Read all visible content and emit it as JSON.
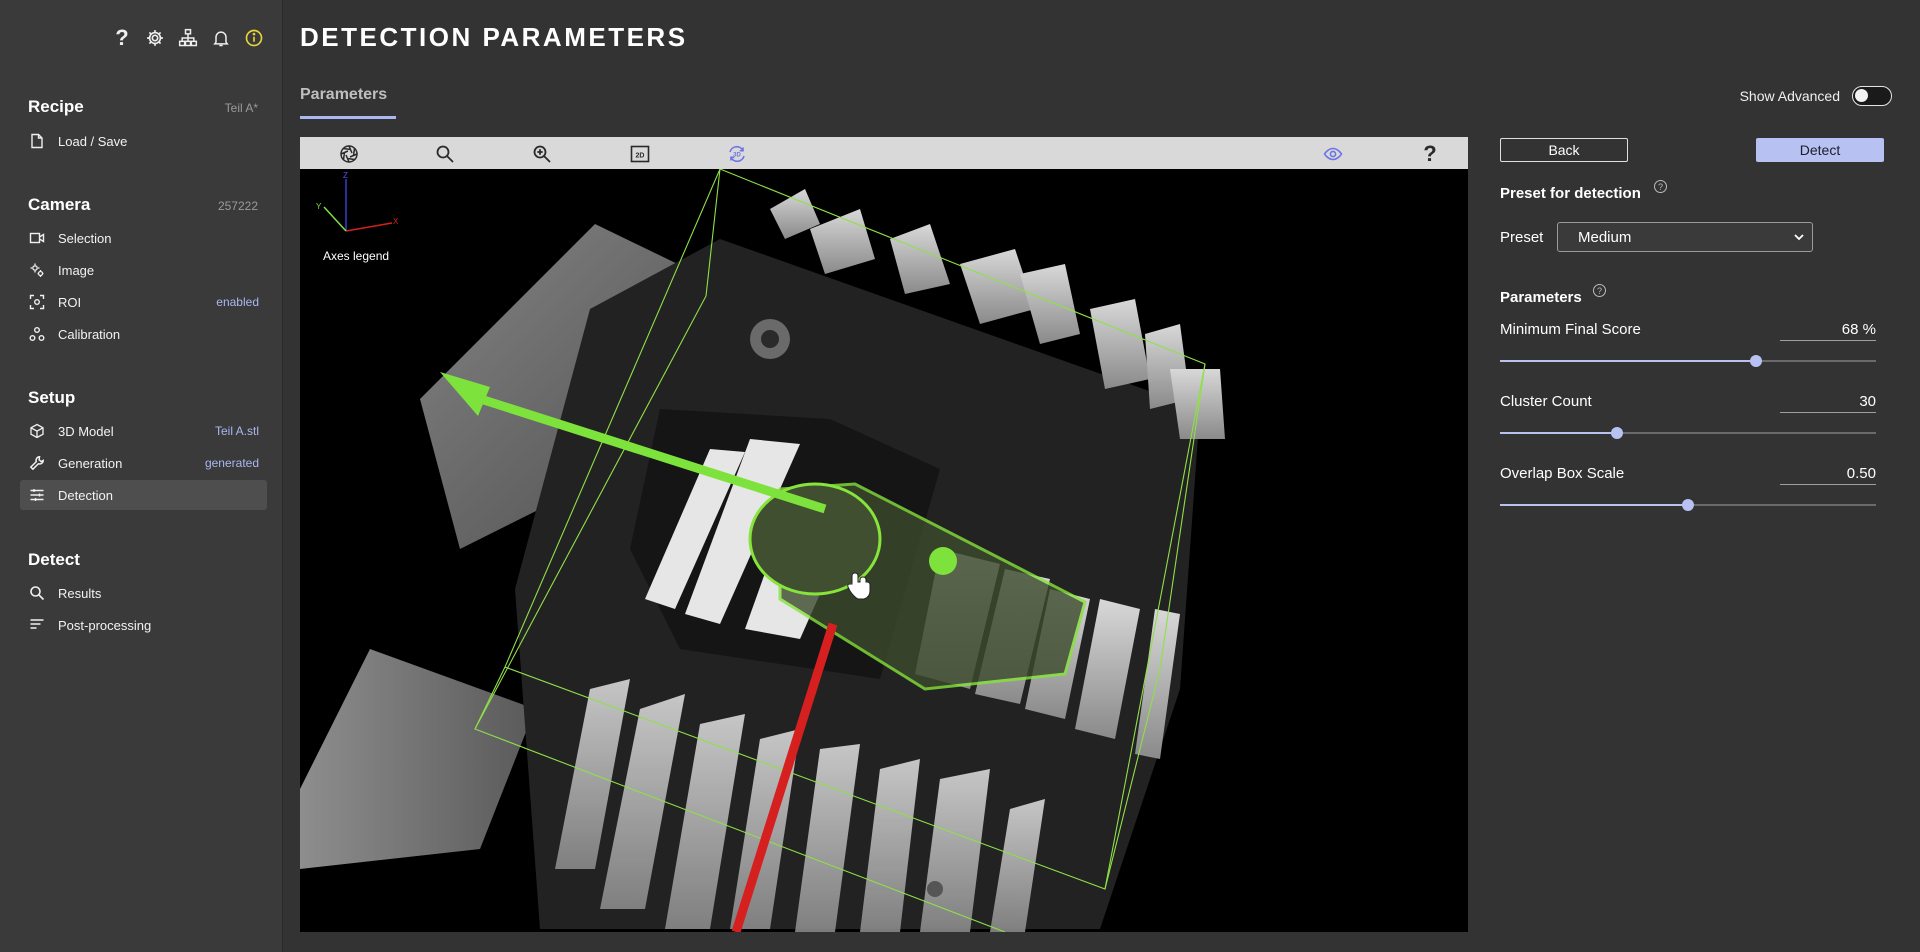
{
  "sidebar": {
    "top_icons": [
      "help-icon",
      "gear-icon",
      "network-icon",
      "bell-icon",
      "info-icon"
    ],
    "sections": [
      {
        "title": "Recipe",
        "meta": "Teil A*",
        "items": [
          {
            "label": "Load / Save",
            "icon": "document-icon",
            "meta": ""
          }
        ]
      },
      {
        "title": "Camera",
        "meta": "257222",
        "items": [
          {
            "label": "Selection",
            "icon": "camera-icon",
            "meta": ""
          },
          {
            "label": "Image",
            "icon": "image-settings-icon",
            "meta": ""
          },
          {
            "label": "ROI",
            "icon": "roi-icon",
            "meta": "enabled"
          },
          {
            "label": "Calibration",
            "icon": "calibration-icon",
            "meta": ""
          }
        ]
      },
      {
        "title": "Setup",
        "meta": "",
        "items": [
          {
            "label": "3D Model",
            "icon": "cube-icon",
            "meta": "Teil A.stl"
          },
          {
            "label": "Generation",
            "icon": "wrench-icon",
            "meta": "generated"
          },
          {
            "label": "Detection",
            "icon": "sliders-icon",
            "meta": "",
            "active": true
          }
        ]
      },
      {
        "title": "Detect",
        "meta": "",
        "items": [
          {
            "label": "Results",
            "icon": "search-icon",
            "meta": ""
          },
          {
            "label": "Post-processing",
            "icon": "lines-icon",
            "meta": ""
          }
        ]
      }
    ]
  },
  "page": {
    "title": "DETECTION PARAMETERS"
  },
  "tabs": [
    {
      "label": "Parameters",
      "active": true
    }
  ],
  "show_advanced": {
    "label": "Show Advanced",
    "on": false
  },
  "viewer": {
    "toolbar_icons": [
      "aperture-icon",
      "search-icon",
      "zoom-in-icon",
      "view-2d-icon",
      "rotate-3d-icon",
      "eye-icon",
      "help-icon"
    ],
    "toolbar_3d_text": "3D",
    "toolbar_2d_text": "2D",
    "axes_legend": "Axes legend",
    "axis_labels": {
      "x": "X",
      "y": "Y",
      "z": "Z"
    }
  },
  "actions": {
    "back": "Back",
    "detect": "Detect"
  },
  "preset": {
    "heading": "Preset for detection",
    "label": "Preset",
    "value": "Medium",
    "help": "?"
  },
  "parameters": {
    "heading": "Parameters",
    "help": "?",
    "items": [
      {
        "label": "Minimum Final Score",
        "display": "68 %",
        "fraction": 0.68
      },
      {
        "label": "Cluster Count",
        "display": "30",
        "fraction": 0.31
      },
      {
        "label": "Overlap Box Scale",
        "display": "0.50",
        "fraction": 0.5
      }
    ]
  },
  "colors": {
    "accent": "#b7c2f3",
    "meta_link": "#a9b8f0",
    "bounding_box": "#8fe048",
    "green_arrow": "#7ee23c",
    "red_axis": "#d62020"
  }
}
